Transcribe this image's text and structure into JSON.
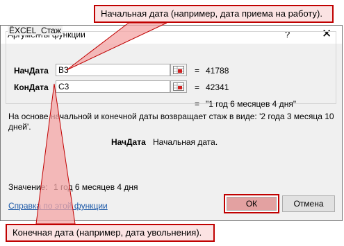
{
  "dialog": {
    "title": "Аргументы функции",
    "help_glyph": "?",
    "close_glyph": "✕"
  },
  "function_name": "ЁXCEL_Стаж",
  "args": [
    {
      "name": "НачДата",
      "value": "B3",
      "eval": "41788"
    },
    {
      "name": "КонДата",
      "value": "C3",
      "eval": "42341"
    }
  ],
  "eq_sign": "=",
  "result_preview": "\"1 год 6 месяцев 4 дня\"",
  "description": "На основе начальной и конечной даты возвращает стаж в виде: '2 года 3 месяца 10 дней'.",
  "current_arg": {
    "name": "НачДата",
    "description": "Начальная дата."
  },
  "value_label": "Значение:",
  "value_text": "1 год 6 месяцев 4 дня",
  "help_link": "Справка по этой функции",
  "buttons": {
    "ok": "ОК",
    "cancel": "Отмена"
  },
  "callouts": {
    "top": "Начальная дата (например, дата приема на работу).",
    "bottom": "Конечная дата (например, дата увольнения)."
  },
  "colors": {
    "accent_red": "#c00000",
    "callout_fill": "#fbe3e3",
    "link": "#1e5aa8"
  }
}
